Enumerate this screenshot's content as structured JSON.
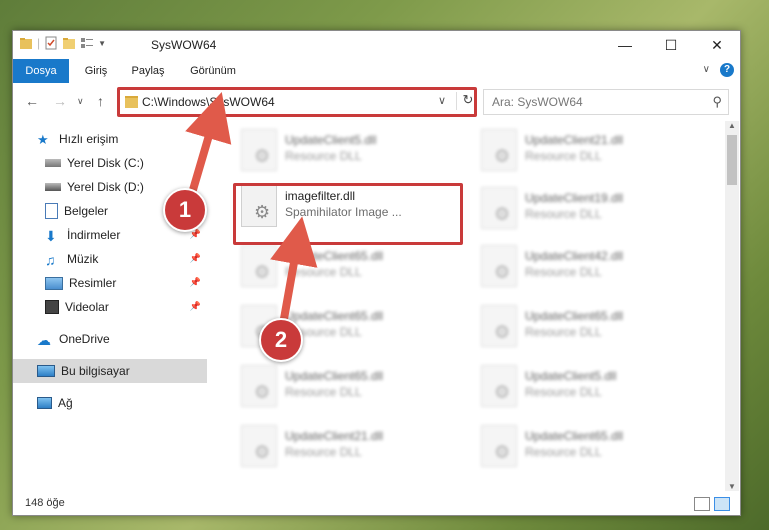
{
  "window": {
    "title": "SysWOW64"
  },
  "ribbon": {
    "tabs": [
      "Dosya",
      "Giriş",
      "Paylaş",
      "Görünüm"
    ]
  },
  "address": {
    "path": "C:\\Windows\\SysWOW64"
  },
  "search": {
    "placeholder": "Ara: SysWOW64"
  },
  "sidebar": {
    "items": [
      {
        "label": "Hızlı erişim"
      },
      {
        "label": "Yerel Disk (C:)"
      },
      {
        "label": "Yerel Disk (D:)"
      },
      {
        "label": "Belgeler"
      },
      {
        "label": "İndirmeler"
      },
      {
        "label": "Müzik"
      },
      {
        "label": "Resimler"
      },
      {
        "label": "Videolar"
      },
      {
        "label": "OneDrive"
      },
      {
        "label": "Bu bilgisayar"
      },
      {
        "label": "Ağ"
      }
    ]
  },
  "files": {
    "highlighted": {
      "name": "imagefilter.dll",
      "type": "Spamihilator Image ..."
    },
    "left": [
      {
        "name": "UpdateClient5.dll",
        "type": "Resource DLL"
      },
      {
        "name": "UpdateClient65.dll",
        "type": "Resource DLL"
      },
      {
        "name": "UpdateClient65.dll",
        "type": "Resource DLL"
      },
      {
        "name": "UpdateClient65.dll",
        "type": "Resource DLL"
      },
      {
        "name": "UpdateClient21.dll",
        "type": "Resource DLL"
      }
    ],
    "right": [
      {
        "name": "UpdateClient21.dll",
        "type": "Resource DLL"
      },
      {
        "name": "UpdateClient19.dll",
        "type": "Resource DLL"
      },
      {
        "name": "UpdateClient42.dll",
        "type": "Resource DLL"
      },
      {
        "name": "UpdateClient65.dll",
        "type": "Resource DLL"
      },
      {
        "name": "UpdateClient5.dll",
        "type": "Resource DLL"
      },
      {
        "name": "UpdateClient65.dll",
        "type": "Resource DLL"
      }
    ]
  },
  "status": {
    "count": "148 öğe"
  },
  "annotations": {
    "step1": "1",
    "step2": "2"
  },
  "colors": {
    "accent": "#1979ca",
    "highlight": "#c93a3a"
  }
}
